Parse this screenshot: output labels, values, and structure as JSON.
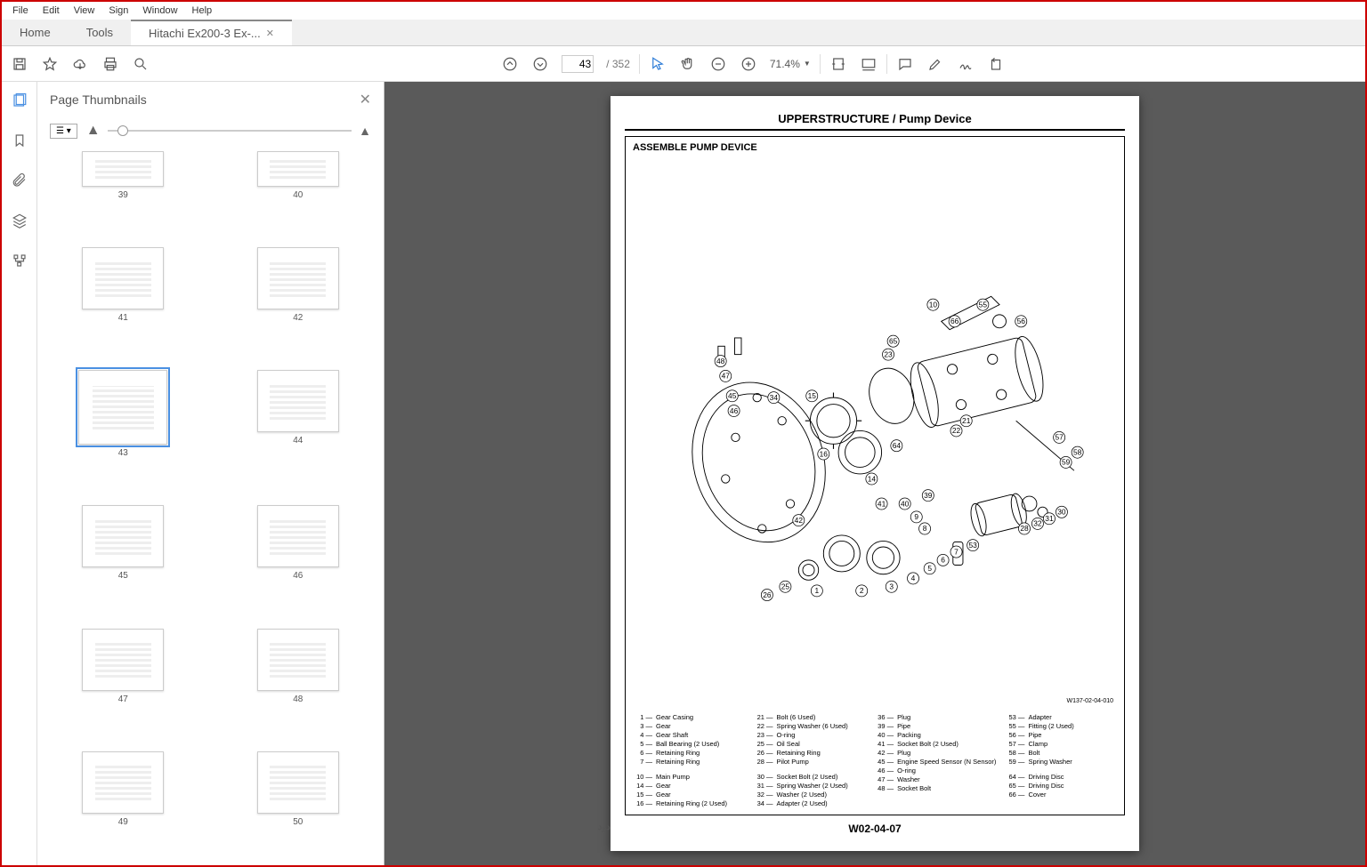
{
  "menu": [
    "File",
    "Edit",
    "View",
    "Sign",
    "Window",
    "Help"
  ],
  "tabs": {
    "home": "Home",
    "tools": "Tools",
    "doc": "Hitachi Ex200-3 Ex-..."
  },
  "toolbar": {
    "page_current": "43",
    "page_total": "/ 352",
    "zoom": "71.4%"
  },
  "thumbpanel": {
    "title": "Page Thumbnails"
  },
  "thumbs": [
    "39",
    "40",
    "41",
    "42",
    "43",
    "44",
    "45",
    "46",
    "47",
    "48",
    "49",
    "50"
  ],
  "doc": {
    "header": "UPPERSTRUCTURE / Pump Device",
    "subheader": "ASSEMBLE PUMP DEVICE",
    "figref": "W137-02-04-010",
    "footer": "W02-04-07",
    "callouts": [
      "1",
      "2",
      "3",
      "4",
      "5",
      "6",
      "7",
      "8",
      "9",
      "10",
      "14",
      "15",
      "16",
      "21",
      "22",
      "23",
      "25",
      "26",
      "28",
      "30",
      "31",
      "32",
      "34",
      "39",
      "40",
      "41",
      "42",
      "45",
      "46",
      "47",
      "48",
      "53",
      "55",
      "56",
      "57",
      "58",
      "59",
      "64",
      "65",
      "66"
    ],
    "legend": [
      [
        {
          "n": "1",
          "d": "Gear Casing"
        },
        {
          "n": "3",
          "d": "Gear"
        },
        {
          "n": "4",
          "d": "Gear Shaft"
        },
        {
          "n": "5",
          "d": "Ball Bearing (2 Used)"
        },
        {
          "n": "6",
          "d": "Retaining Ring"
        },
        {
          "n": "7",
          "d": "Retaining Ring"
        },
        {
          "gap": true
        },
        {
          "n": "10",
          "d": "Main Pump"
        },
        {
          "n": "14",
          "d": "Gear"
        },
        {
          "n": "15",
          "d": "Gear"
        },
        {
          "n": "16",
          "d": "Retaining Ring (2 Used)"
        }
      ],
      [
        {
          "n": "21",
          "d": "Bolt (6 Used)"
        },
        {
          "n": "22",
          "d": "Spring Washer (6 Used)"
        },
        {
          "n": "23",
          "d": "O-ring"
        },
        {
          "n": "25",
          "d": "Oil Seal"
        },
        {
          "n": "26",
          "d": "Retaining Ring"
        },
        {
          "n": "28",
          "d": "Pilot Pump"
        },
        {
          "gap": true
        },
        {
          "n": "30",
          "d": "Socket Bolt (2 Used)"
        },
        {
          "n": "31",
          "d": "Spring Washer (2 Used)"
        },
        {
          "n": "32",
          "d": "Washer (2 Used)"
        },
        {
          "n": "34",
          "d": "Adapter (2 Used)"
        }
      ],
      [
        {
          "n": "36",
          "d": "Plug"
        },
        {
          "n": "39",
          "d": "Pipe"
        },
        {
          "n": "40",
          "d": "Packing"
        },
        {
          "n": "41",
          "d": "Socket Bolt (2 Used)"
        },
        {
          "n": "42",
          "d": "Plug"
        },
        {
          "n": "45",
          "d": "Engine Speed Sensor (N Sensor)"
        },
        {
          "n": "46",
          "d": "O-ring"
        },
        {
          "n": "47",
          "d": "Washer"
        },
        {
          "n": "48",
          "d": "Socket Bolt"
        }
      ],
      [
        {
          "n": "53",
          "d": "Adapter"
        },
        {
          "n": "55",
          "d": "Fitting (2 Used)"
        },
        {
          "n": "56",
          "d": "Pipe"
        },
        {
          "n": "57",
          "d": "Clamp"
        },
        {
          "n": "58",
          "d": "Bolt"
        },
        {
          "n": "59",
          "d": "Spring Washer"
        },
        {
          "gap": true
        },
        {
          "n": "64",
          "d": "Driving Disc"
        },
        {
          "n": "65",
          "d": "Driving Disc"
        },
        {
          "n": "66",
          "d": "Cover"
        }
      ]
    ]
  }
}
